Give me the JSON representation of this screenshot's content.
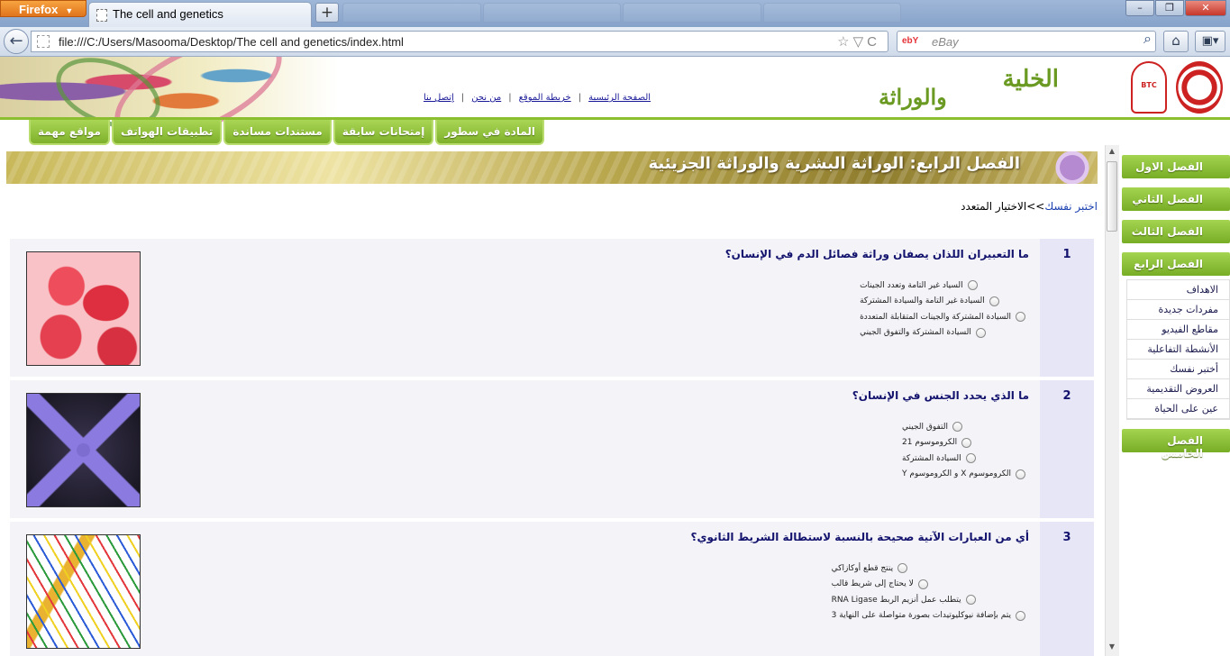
{
  "browser": {
    "menu_label": "Firefox",
    "tab_title": "The cell and genetics",
    "new_tab": "+",
    "url": "file:///C:/Users/Masooma/Desktop/The cell and genetics/index.html",
    "search_placeholder": "eBay",
    "search_engine": "ebY",
    "window_controls": [
      "–",
      "❐",
      "✕"
    ]
  },
  "site": {
    "logo_line1": "الخلية",
    "logo_line2": "والوراثة",
    "logo_badge": "BTC",
    "top_links": [
      "الصفحة الرئيسية",
      "خريطة الموقع",
      "من نحن",
      "إتصل بنا"
    ],
    "top_nav": [
      "المادة في سطور",
      "إمتحانات سابقة",
      "مستندات مساندة",
      "تطبيقات الهواتف",
      "مواقع مهمة"
    ]
  },
  "banner": {
    "title": "الفصل الرابع: الوراثة البشرية والوراثة الجزيئية"
  },
  "breadcrumb": {
    "link": "اختبر نفسك",
    "separator": ">>",
    "current": "الاختيار المتعدد"
  },
  "questions": [
    {
      "number": "1",
      "text": "ما التعبيران اللذان يصفان وراثة فصائل الدم في الإنسان؟",
      "options": [
        "السياد غير التامة وتعدد الجينات",
        "السيادة غير التامة والسيادة المشتركة",
        "السيادة المشتركة والجينات المتقابلة المتعددة",
        "السيادة المشتركة والتفوق الجيني"
      ],
      "image": "red-blood-cells"
    },
    {
      "number": "2",
      "text": "ما الذي يحدد الجنس في الإنسان؟",
      "options": [
        "التفوق الجيني",
        "الكروموسوم 21",
        "السيادة المشتركة",
        "الكروموسوم X و الكروموسوم Y"
      ],
      "image": "chromosome"
    },
    {
      "number": "3",
      "text": "أي من العبارات الآتية صحيحة بالنسبة لاستطالة الشريط الثانوي؟",
      "options": [
        "ينتج قطع أوكازاكي",
        "لا يحتاج إلى شريط قالب",
        "يتطلب عمل أنزيم الربط RNA Ligase",
        "يتم بإضافة نيوكليوتيدات بصورة متواصلة على النهاية 3"
      ],
      "image": "dna-helix"
    }
  ],
  "sidebar": {
    "chapters": [
      "الفصل الاول",
      "الفصل الثاني",
      "الفصل الثالث",
      "الفصل الرابع",
      "الفصل الخامس"
    ],
    "chapter4_items": [
      "الاهداف",
      "مفردات جديدة",
      "مقاطع الفيديو",
      "الأنشطة التفاعلية",
      "أختبر نفسك",
      "العروض التقديمية",
      "عين على الحياة"
    ]
  },
  "colors": {
    "accent_green": "#8cbf2f",
    "question_text": "#13136e",
    "link_blue": "#1a3fb0"
  }
}
